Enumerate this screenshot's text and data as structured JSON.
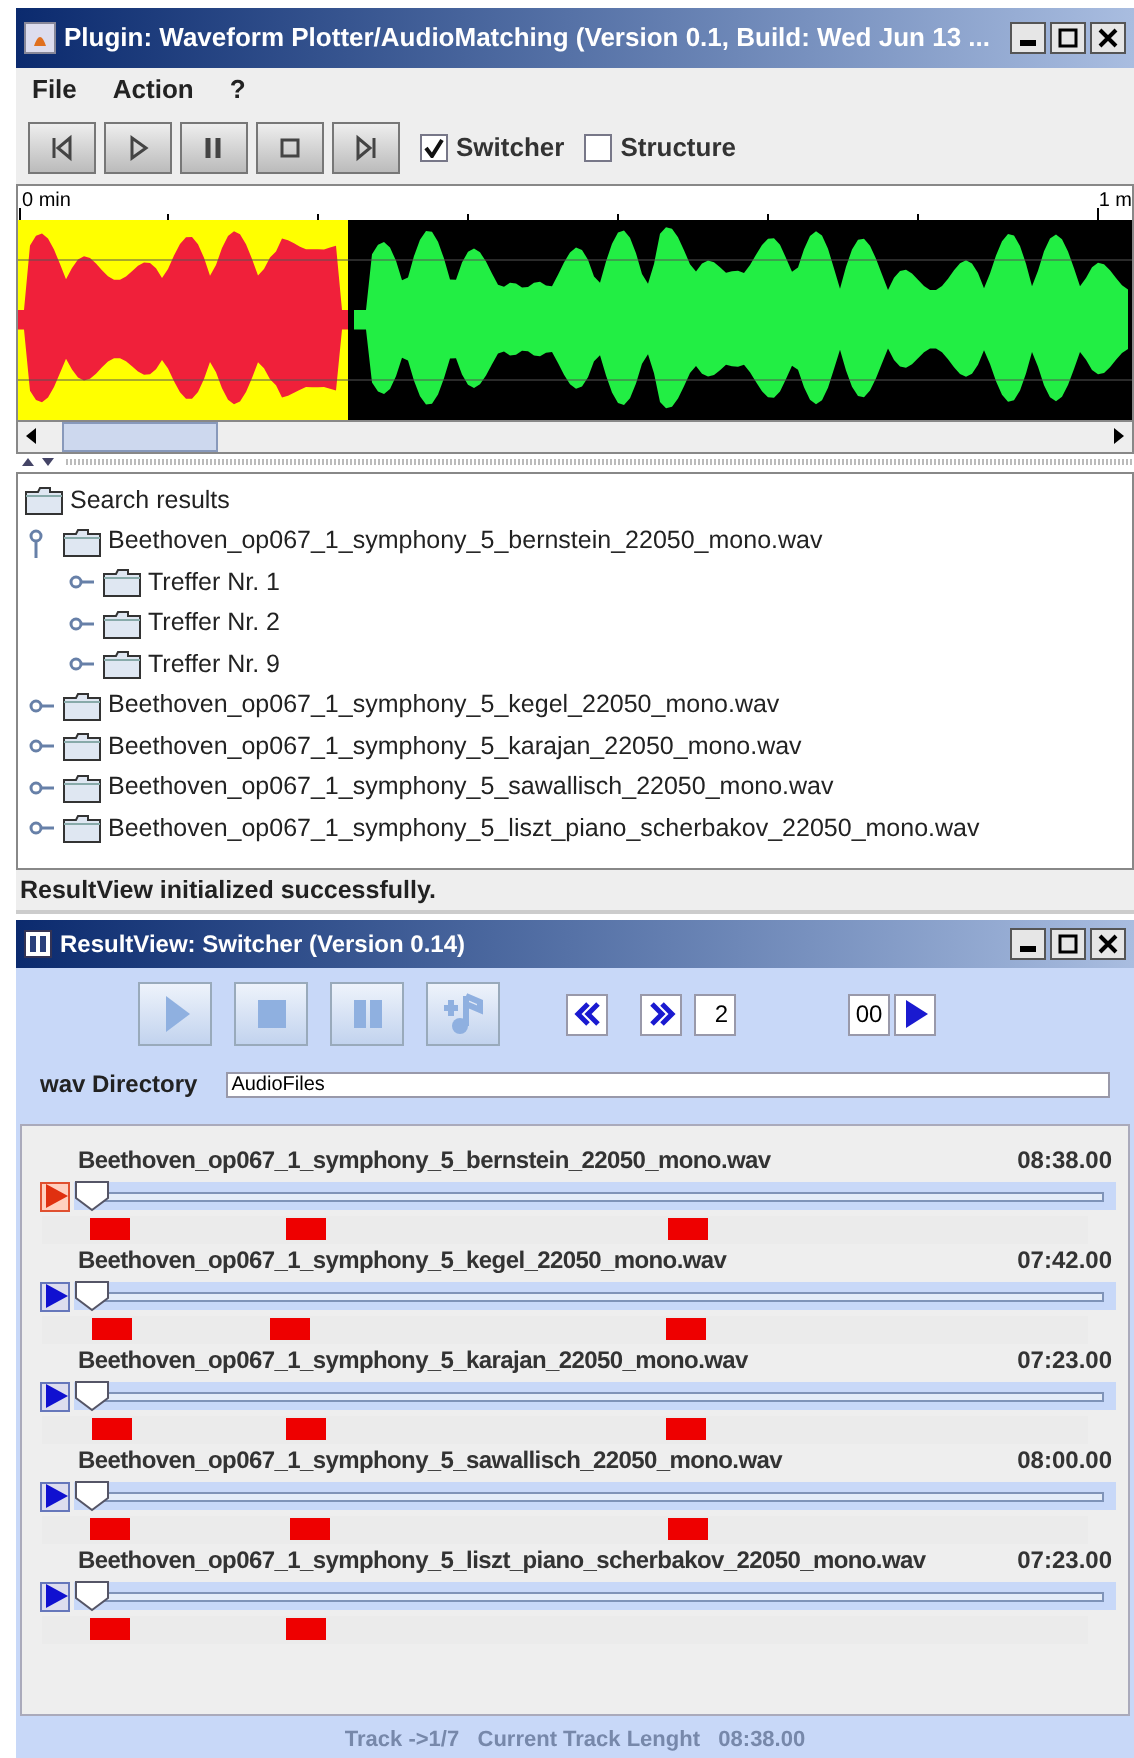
{
  "window": {
    "title": "Plugin: Waveform Plotter/AudioMatching (Version 0.1, Build: Wed Jun 13 ..."
  },
  "menu": [
    "File",
    "Action",
    "?"
  ],
  "toolbar": {
    "switcher": {
      "label": "Switcher",
      "checked": true
    },
    "structure": {
      "label": "Structure",
      "checked": false
    }
  },
  "waveform": {
    "start_label": "0 min",
    "end_label": "1 m"
  },
  "tree": {
    "label": "Search results",
    "children": [
      {
        "label": "Beethoven_op067_1_symphony_5_bernstein_22050_mono.wav",
        "expanded": true,
        "children": [
          {
            "label": "Treffer Nr. 1",
            "expanded": false
          },
          {
            "label": "Treffer Nr. 2",
            "expanded": false
          },
          {
            "label": "Treffer Nr. 9",
            "expanded": false
          }
        ]
      },
      {
        "label": "Beethoven_op067_1_symphony_5_kegel_22050_mono.wav",
        "expanded": false
      },
      {
        "label": "Beethoven_op067_1_symphony_5_karajan_22050_mono.wav",
        "expanded": false
      },
      {
        "label": "Beethoven_op067_1_symphony_5_sawallisch_22050_mono.wav",
        "expanded": false
      },
      {
        "label": "Beethoven_op067_1_symphony_5_liszt_piano_scherbakov_22050_mono.wav",
        "expanded": false
      }
    ]
  },
  "status": "ResultView initialized successfully.",
  "switcher": {
    "title": "ResultView: Switcher (Version 0.14)",
    "track_number": "2",
    "time_field": "00",
    "wav_directory": {
      "label": "wav Directory",
      "value": "AudioFiles"
    },
    "tracks": [
      {
        "name": "Beethoven_op067_1_symphony_5_bernstein_22050_mono.wav",
        "duration": "08:38.00",
        "playing": true,
        "level": 0,
        "markers": [
          {
            "level": 0.046
          },
          {
            "level": 0.233
          },
          {
            "level": 0.598
          }
        ]
      },
      {
        "name": "Beethoven_op067_1_symphony_5_kegel_22050_mono.wav",
        "duration": "07:42.00",
        "playing": false,
        "level": 0,
        "markers": [
          {
            "level": 0.048
          },
          {
            "level": 0.218
          },
          {
            "level": 0.597
          }
        ]
      },
      {
        "name": "Beethoven_op067_1_symphony_5_karajan_22050_mono.wav",
        "duration": "07:23.00",
        "playing": false,
        "level": 0,
        "markers": [
          {
            "level": 0.048
          },
          {
            "level": 0.233
          },
          {
            "level": 0.597
          }
        ]
      },
      {
        "name": "Beethoven_op067_1_symphony_5_sawallisch_22050_mono.wav",
        "duration": "08:00.00",
        "playing": false,
        "level": 0,
        "markers": [
          {
            "level": 0.046
          },
          {
            "level": 0.237
          },
          {
            "level": 0.598
          }
        ]
      },
      {
        "name": "Beethoven_op067_1_symphony_5_liszt_piano_scherbakov_22050_mono.wav",
        "duration": "07:23.00",
        "playing": false,
        "level": 0,
        "markers": [
          {
            "level": 0.046
          },
          {
            "level": 0.233
          }
        ]
      }
    ],
    "status_bar": "Track ->1/7   Current Track Lenght   08:38.00"
  }
}
